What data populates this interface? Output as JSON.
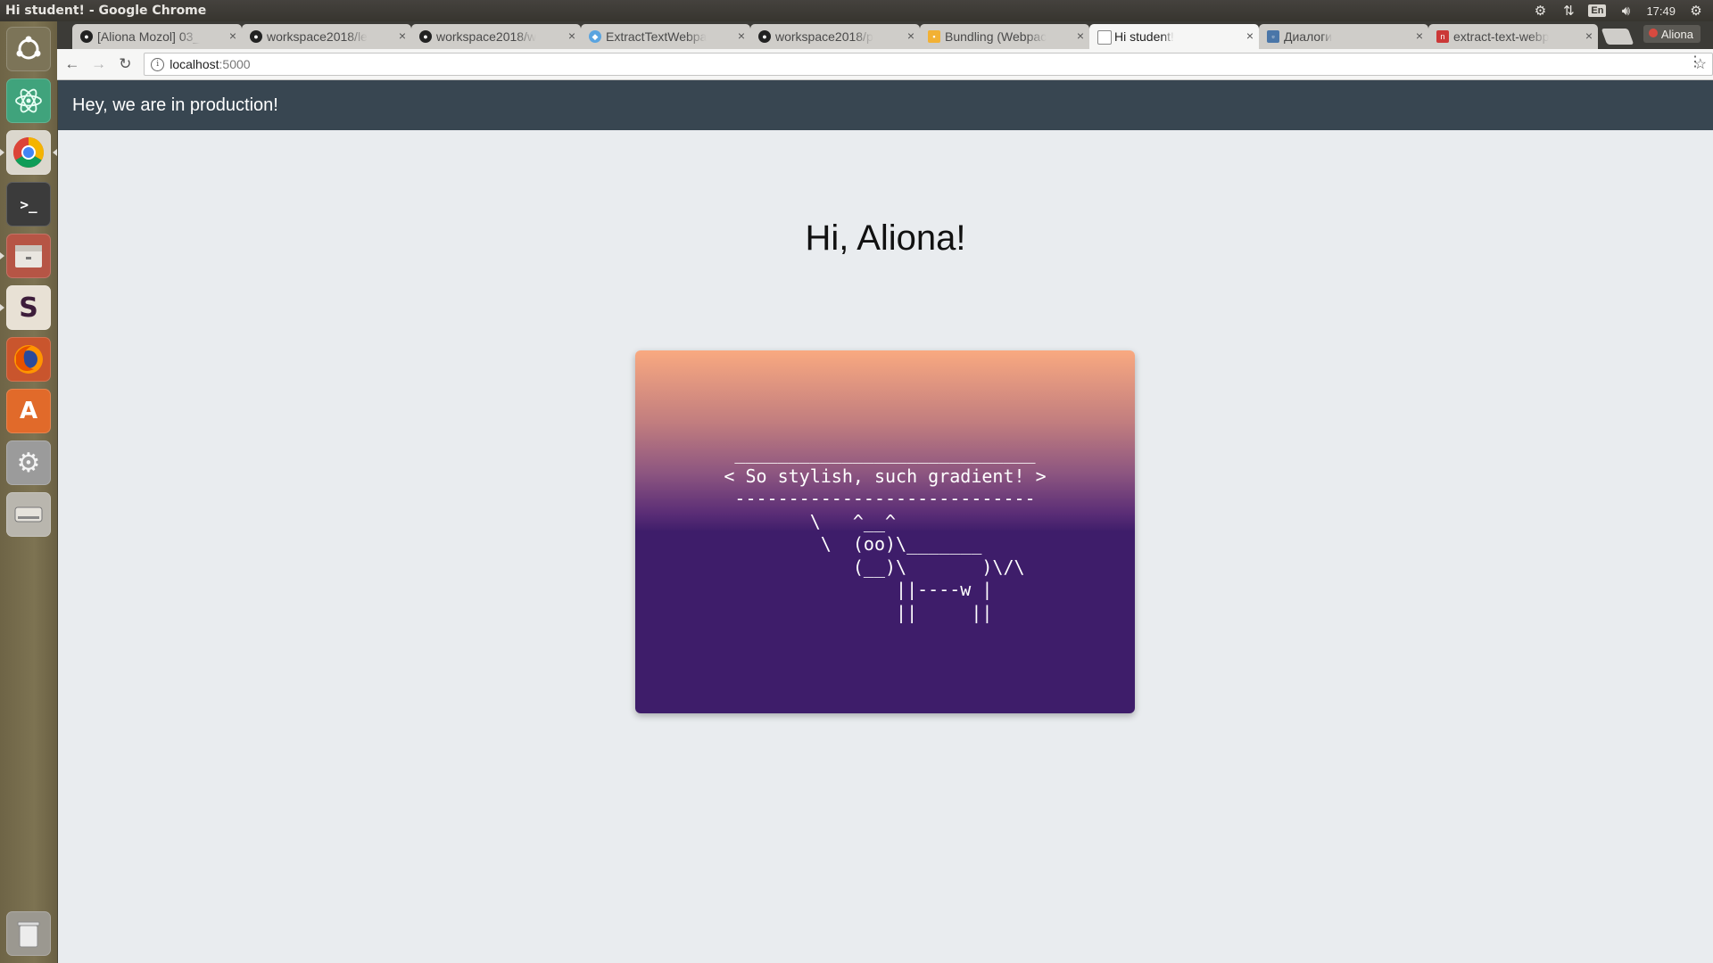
{
  "os": {
    "window_title": "Hi student! - Google Chrome",
    "keyboard_layout": "En",
    "clock": "17:49",
    "tray_icons": [
      "network-sync-icon",
      "transfer-arrows-icon",
      "keyboard-layout-icon",
      "volume-icon",
      "settings-gear-icon"
    ]
  },
  "launcher": {
    "items": [
      {
        "name": "ubuntu-dash-icon",
        "color": "#7c7458"
      },
      {
        "name": "atom-editor-icon",
        "color": "#40a37c"
      },
      {
        "name": "chrome-icon",
        "color": "#dbd7cd"
      },
      {
        "name": "terminal-icon",
        "color": "#3b3b3b"
      },
      {
        "name": "files-icon",
        "color": "#b65545"
      },
      {
        "name": "slack-icon",
        "color": "#e8e1d5"
      },
      {
        "name": "firefox-icon",
        "color": "#c9552d"
      },
      {
        "name": "software-center-icon",
        "color": "#e16a2a"
      },
      {
        "name": "system-settings-icon",
        "color": "#9b9b9b"
      },
      {
        "name": "drive-icon",
        "color": "#b9b6ae"
      },
      {
        "name": "trash-icon",
        "color": "#9b9890"
      }
    ]
  },
  "browser": {
    "tabs": [
      {
        "title": "[Aliona Mozol] 03_",
        "favicon": "github-icon",
        "active": false
      },
      {
        "title": "workspace2018/le",
        "favicon": "github-icon",
        "active": false
      },
      {
        "title": "workspace2018/w",
        "favicon": "github-icon",
        "active": false
      },
      {
        "title": "ExtractTextWebpa",
        "favicon": "webpack-icon",
        "active": false
      },
      {
        "title": "workspace2018/p",
        "favicon": "github-icon",
        "active": false
      },
      {
        "title": "Bundling (Webpac",
        "favicon": "document-icon",
        "active": false
      },
      {
        "title": "Hi student!",
        "favicon": "page-icon",
        "active": true
      },
      {
        "title": "Диалоги",
        "favicon": "vk-icon",
        "active": false
      },
      {
        "title": "extract-text-webp",
        "favicon": "npm-icon",
        "active": false
      }
    ],
    "profile_name": "Aliona",
    "url_host": "localhost",
    "url_port": ":5000"
  },
  "page": {
    "header_text": "Hey, we are in production!",
    "greeting": "Hi, Aliona!",
    "cowsay": " ____________________________\n< So stylish, such gradient! >\n ----------------------------\n        \\   ^__^\n         \\  (oo)\\_______\n            (__)\\       )\\/\\\n                ||----w |\n                ||     ||",
    "header_color": "#384651",
    "background_color": "#e9ecef",
    "gradient_colors": [
      "#f9a980",
      "#8c5580",
      "#3e1d6a"
    ]
  }
}
